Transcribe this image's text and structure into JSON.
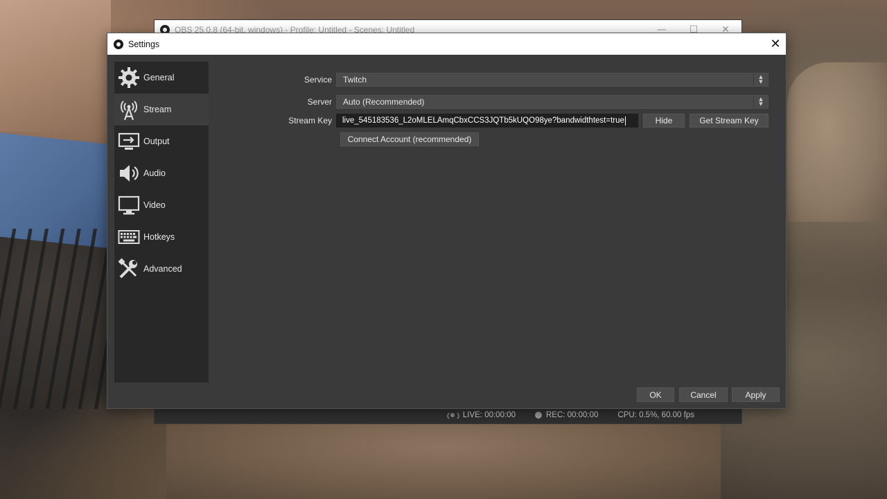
{
  "main_window": {
    "title": "OBS 25.0.8 (64-bit, windows) - Profile: Untitled - Scenes: Untitled",
    "controls": {
      "minimize": "—",
      "maximize": "☐",
      "close": "✕"
    },
    "status": {
      "live": "LIVE: 00:00:00",
      "rec": "REC: 00:00:00",
      "cpu": "CPU: 0.5%, 60.00 fps"
    }
  },
  "settings": {
    "title": "Settings",
    "close": "✕",
    "sidebar": {
      "items": [
        {
          "label": "General",
          "icon": "gear-icon"
        },
        {
          "label": "Stream",
          "icon": "broadcast-antenna-icon"
        },
        {
          "label": "Output",
          "icon": "output-monitor-icon"
        },
        {
          "label": "Audio",
          "icon": "speaker-icon"
        },
        {
          "label": "Video",
          "icon": "monitor-icon"
        },
        {
          "label": "Hotkeys",
          "icon": "keyboard-icon"
        },
        {
          "label": "Advanced",
          "icon": "tools-icon"
        }
      ],
      "active": "Stream"
    },
    "stream": {
      "service_label": "Service",
      "service_value": "Twitch",
      "server_label": "Server",
      "server_value": "Auto (Recommended)",
      "stream_key_label": "Stream Key",
      "stream_key_value": "live_545183536_L2oMLELAmqCbxCCS3JQTb5kUQO98ye?bandwidthtest=true",
      "hide_button": "Hide",
      "get_key_button": "Get Stream Key",
      "connect_button": "Connect Account (recommended)"
    },
    "buttons": {
      "ok": "OK",
      "cancel": "Cancel",
      "apply": "Apply"
    }
  }
}
